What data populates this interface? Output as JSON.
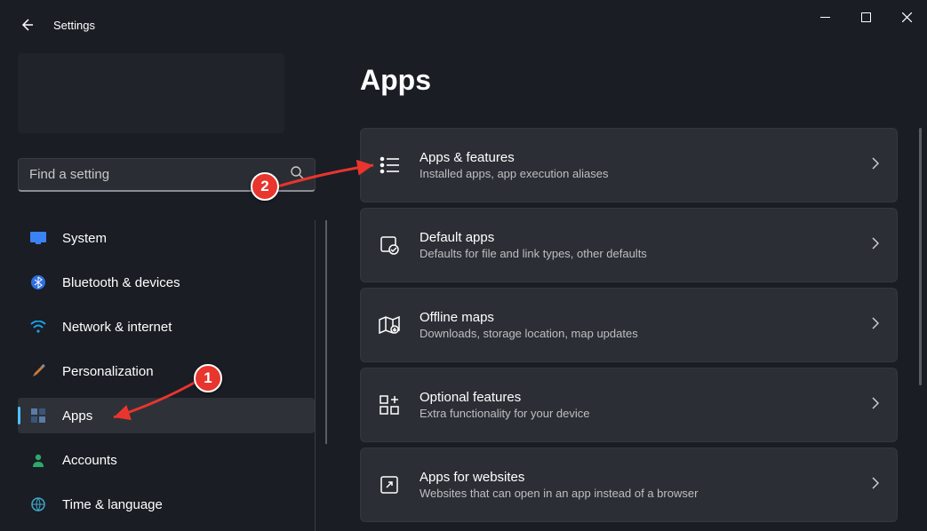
{
  "window": {
    "title": "Settings"
  },
  "search": {
    "placeholder": "Find a setting"
  },
  "sidebar": {
    "items": [
      {
        "label": "System",
        "active": false
      },
      {
        "label": "Bluetooth & devices",
        "active": false
      },
      {
        "label": "Network & internet",
        "active": false
      },
      {
        "label": "Personalization",
        "active": false
      },
      {
        "label": "Apps",
        "active": true
      },
      {
        "label": "Accounts",
        "active": false
      },
      {
        "label": "Time & language",
        "active": false
      }
    ]
  },
  "page": {
    "title": "Apps"
  },
  "cards": [
    {
      "title": "Apps & features",
      "subtitle": "Installed apps, app execution aliases"
    },
    {
      "title": "Default apps",
      "subtitle": "Defaults for file and link types, other defaults"
    },
    {
      "title": "Offline maps",
      "subtitle": "Downloads, storage location, map updates"
    },
    {
      "title": "Optional features",
      "subtitle": "Extra functionality for your device"
    },
    {
      "title": "Apps for websites",
      "subtitle": "Websites that can open in an app instead of a browser"
    }
  ],
  "annotations": {
    "badge1": "1",
    "badge2": "2"
  },
  "colors": {
    "accent": "#4cc2ff",
    "badge": "#e8352e"
  }
}
